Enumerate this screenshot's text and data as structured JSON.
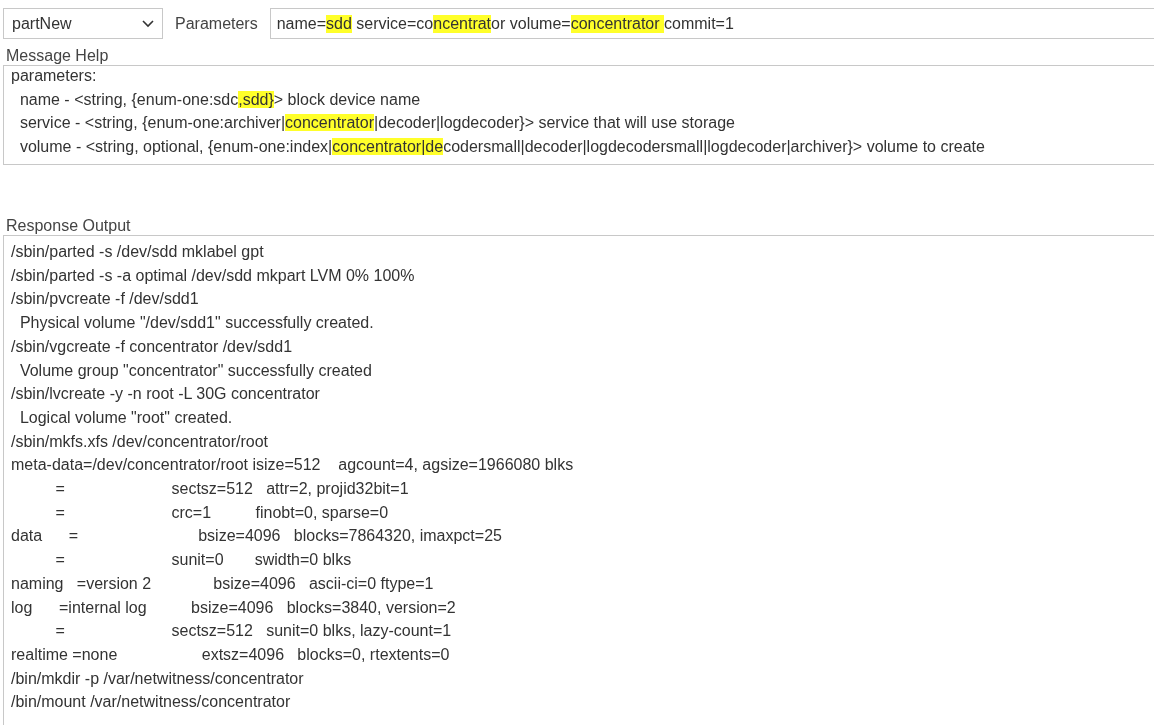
{
  "command_select": {
    "value": "partNew"
  },
  "parameters": {
    "label": "Parameters",
    "segments": [
      {
        "text": "name=",
        "highlighted": false
      },
      {
        "text": "sdd",
        "highlighted": true
      },
      {
        "text": " service=co",
        "highlighted": false
      },
      {
        "text": "ncentrat",
        "highlighted": true
      },
      {
        "text": "or volume=",
        "highlighted": false
      },
      {
        "text": "concentrator ",
        "highlighted": true
      },
      {
        "text": "commit=1",
        "highlighted": false
      }
    ]
  },
  "message_help": {
    "label": "Message Help",
    "lines": [
      [
        {
          "text": "parameters:",
          "highlighted": false
        }
      ],
      [
        {
          "text": "  name - <string, {enum-one:sdc",
          "highlighted": false
        },
        {
          "text": ",sdd}",
          "highlighted": true
        },
        {
          "text": "> block device name",
          "highlighted": false
        }
      ],
      [
        {
          "text": "  service - <string, {enum-one:archiver|",
          "highlighted": false
        },
        {
          "text": "concentrator",
          "highlighted": true
        },
        {
          "text": "|decoder|logdecoder}> service that will use storage",
          "highlighted": false
        }
      ],
      [
        {
          "text": "  volume - <string, optional, {enum-one:index|",
          "highlighted": false
        },
        {
          "text": "concentrator|de",
          "highlighted": true
        },
        {
          "text": "codersmall|decoder|logdecodersmall|logdecoder|archiver}> volume to create",
          "highlighted": false
        }
      ]
    ]
  },
  "response_output": {
    "label": "Response Output",
    "lines": [
      "/sbin/parted -s /dev/sdd mklabel gpt",
      "/sbin/parted -s -a optimal /dev/sdd mkpart LVM 0% 100%",
      "/sbin/pvcreate -f /dev/sdd1",
      "  Physical volume \"/dev/sdd1\" successfully created.",
      "/sbin/vgcreate -f concentrator /dev/sdd1",
      "  Volume group \"concentrator\" successfully created",
      "/sbin/lvcreate -y -n root -L 30G concentrator",
      "  Logical volume \"root\" created.",
      "/sbin/mkfs.xfs /dev/concentrator/root",
      "meta-data=/dev/concentrator/root isize=512    agcount=4, agsize=1966080 blks",
      "          =                        sectsz=512   attr=2, projid32bit=1",
      "          =                        crc=1          finobt=0, sparse=0",
      "data      =                           bsize=4096   blocks=7864320, imaxpct=25",
      "          =                        sunit=0       swidth=0 blks",
      "naming   =version 2              bsize=4096   ascii-ci=0 ftype=1",
      "log      =internal log          bsize=4096   blocks=3840, version=2",
      "          =                        sectsz=512   sunit=0 blks, lazy-count=1",
      "realtime =none                   extsz=4096   blocks=0, rtextents=0",
      "/bin/mkdir -p /var/netwitness/concentrator",
      "/bin/mount /var/netwitness/concentrator"
    ]
  }
}
